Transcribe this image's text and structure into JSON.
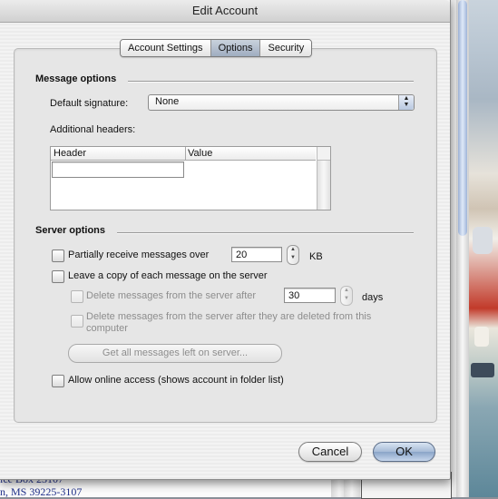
{
  "background": {
    "doc_top_fragment": "",
    "doc_lines": [
      "ice Box 23107",
      "n, MS  39225-3107"
    ]
  },
  "dialog": {
    "title": "Edit Account",
    "tabs": [
      {
        "label": "Account Settings",
        "active": false
      },
      {
        "label": "Options",
        "active": true
      },
      {
        "label": "Security",
        "active": false
      }
    ],
    "message_options": {
      "title": "Message options",
      "default_signature_label": "Default signature:",
      "default_signature_value": "None",
      "additional_headers_label": "Additional headers:",
      "table": {
        "columns": [
          "Header",
          "Value"
        ],
        "rows": []
      }
    },
    "server_options": {
      "title": "Server options",
      "partially_receive_label": "Partially receive messages over",
      "partially_receive_value": "20",
      "partially_receive_unit": "KB",
      "leave_copy_label": "Leave a copy of each message on the server",
      "delete_after_label": "Delete messages from the server after",
      "delete_after_value": "30",
      "delete_after_unit": "days",
      "delete_when_deleted_label_line1": "Delete messages from the server after they are deleted from this",
      "delete_when_deleted_label_line2": "computer",
      "get_all_button": "Get all messages left on server...",
      "allow_online_label": "Allow online access (shows account in folder list)"
    },
    "buttons": {
      "cancel": "Cancel",
      "ok": "OK"
    }
  },
  "colors": {
    "default_button": "#a6bbd6",
    "active_tab": "#a9b6c8"
  }
}
